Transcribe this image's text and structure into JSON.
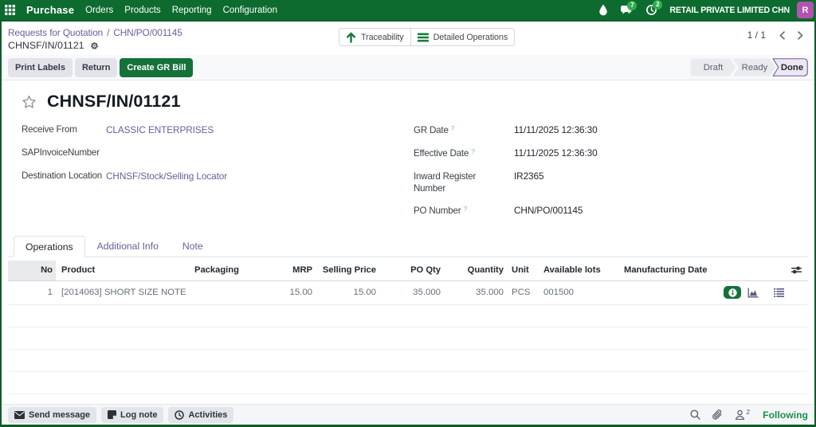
{
  "topbar": {
    "app_name": "Purchase",
    "menu": [
      "Orders",
      "Products",
      "Reporting",
      "Configuration"
    ],
    "chat_badge": "7",
    "activity_badge": "2",
    "company": "RETAIL PRIVATE LIMITED CHN",
    "avatar_initial": "R",
    "icons": [
      "apps-grid-icon",
      "drop-icon",
      "chat-bubbles-icon",
      "activity-clock-icon"
    ],
    "colors": {
      "navbar": "#0d6b2f",
      "badge": "#2fae4e",
      "avatar": "#b352b0"
    }
  },
  "breadcrumb": {
    "level1": "Requests for Quotation",
    "separator": "/",
    "level2": "CHN/PO/001145",
    "current": "CHNSF/IN/01121",
    "icons": [
      "gear-icon"
    ]
  },
  "smart_buttons": [
    {
      "label": "Traceability",
      "icon": "arrow-up-icon"
    },
    {
      "label": "Detailed Operations",
      "icon": "bars-icon"
    }
  ],
  "pager": {
    "count": "1 / 1",
    "icons": [
      "chevron-left-icon",
      "chevron-right-icon"
    ]
  },
  "actions": {
    "secondary": [
      "Print Labels",
      "Return"
    ],
    "primary": "Create GR Bill",
    "primary_color": "#15713a"
  },
  "statusbar": {
    "steps": [
      "Draft",
      "Ready",
      "Done"
    ],
    "active_step": "Done",
    "active_colors": {
      "background": "#ece7f2",
      "border": "#6f5e9b"
    }
  },
  "record": {
    "title": "CHNSF/IN/01121",
    "fields_left": [
      {
        "label": "Receive From",
        "value": "CLASSIC ENTERPRISES",
        "is_link": true
      },
      {
        "label": "SAPInvoiceNumber",
        "value": "",
        "is_link": false
      },
      {
        "label": "Destination Location",
        "value": "CHNSF/Stock/Selling Locator",
        "is_link": true
      }
    ],
    "fields_right": [
      {
        "label": "GR Date",
        "help": "?",
        "value": "11/11/2025 12:36:30"
      },
      {
        "label": "Effective Date",
        "help": "?",
        "value": "11/11/2025 12:36:30"
      },
      {
        "label": "Inward Register Number",
        "help": "",
        "value": "IR2365"
      },
      {
        "label": "PO Number",
        "help": "?",
        "value": "CHN/PO/001145"
      }
    ],
    "link_color": "#675f9e"
  },
  "tabs": [
    {
      "label": "Operations",
      "active": true
    },
    {
      "label": "Additional Info",
      "active": false
    },
    {
      "label": "Note",
      "active": false
    }
  ],
  "chart_data": {
    "type": "table",
    "title": "Operations lines",
    "columns": [
      "No",
      "Product",
      "Packaging",
      "MRP",
      "Selling Price",
      "PO Qty",
      "Quantity",
      "Unit",
      "Available lots",
      "Manufacturing Date"
    ],
    "rows": [
      {
        "no": "1",
        "product": "[2014063] SHORT SIZE NOTE",
        "packaging": "",
        "mrp": "15.00",
        "selling_price": "15.00",
        "po_qty": "35.000",
        "quantity": "35.000",
        "unit": "PCS",
        "available_lots": "001500",
        "manufacturing_date": "",
        "row_icons": [
          "info-pill-icon",
          "area-chart-icon",
          "list-rows-icon"
        ]
      }
    ],
    "header_icon": "column-sliders-icon"
  },
  "chatter": {
    "buttons": [
      {
        "label": "Send message",
        "icon": "envelope-icon"
      },
      {
        "label": "Log note",
        "icon": "note-icon"
      },
      {
        "label": "Activities",
        "icon": "clock-icon"
      }
    ],
    "right_icons": [
      "search-icon",
      "paperclip-icon",
      "followers-icon"
    ],
    "follower_count": "2",
    "following_label": "Following",
    "following_color": "#17914a"
  }
}
